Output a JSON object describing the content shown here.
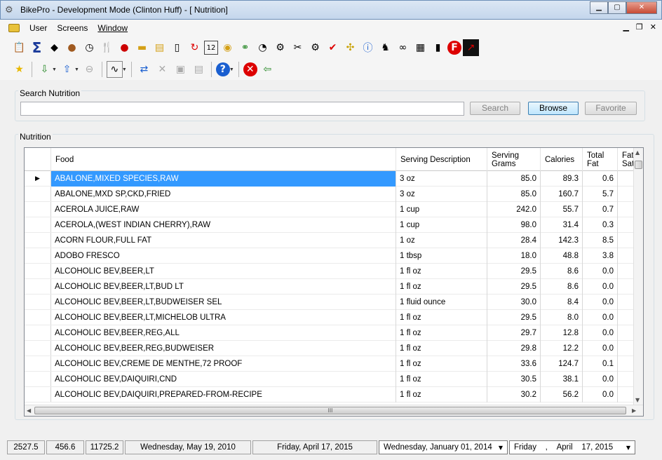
{
  "window": {
    "title": "BikePro - Development Mode (Clinton Huff) - [ Nutrition]"
  },
  "menu": {
    "items": [
      "User",
      "Screens",
      "Window"
    ]
  },
  "toolbar1": {
    "icons": [
      "report-icon",
      "sigma-icon",
      "weight-icon",
      "person-icon",
      "stopwatch-icon",
      "fork-knife-icon",
      "apple-icon",
      "folder-icon",
      "notebook-icon",
      "phone-icon",
      "refresh-red-icon",
      "calendar-icon",
      "medal-icon",
      "bicycle-icon",
      "gauge-icon",
      "bike-parts-icon",
      "tools-icon",
      "gear-wheel-icon",
      "check-icon",
      "molecule-icon",
      "info-icon",
      "animal-icon",
      "binoculars-icon",
      "documents-icon",
      "device-icon",
      "f-logo-icon",
      "chart-red-icon"
    ]
  },
  "toolbar2": {
    "icons": [
      "star-icon",
      "import-icon",
      "export-icon",
      "back-icon",
      "chart-icon",
      "sync-icon",
      "delete-icon",
      "save-icon",
      "save-all-icon",
      "help-icon",
      "cancel-icon",
      "exit-icon"
    ],
    "calendar_day": "12"
  },
  "search": {
    "label": "Search Nutrition",
    "value": "",
    "search_btn": "Search",
    "browse_btn": "Browse",
    "favorite_btn": "Favorite"
  },
  "nutrition": {
    "label": "Nutrition"
  },
  "grid": {
    "columns": [
      {
        "label": "Food",
        "w": 492
      },
      {
        "label": "Serving Description",
        "w": 130
      },
      {
        "label": "Serving\nGrams",
        "w": 76
      },
      {
        "label": "Calories",
        "w": 60
      },
      {
        "label": "Total\nFat",
        "w": 50
      },
      {
        "label": "Fat\nSat",
        "w": 24
      }
    ],
    "rows": [
      [
        "ABALONE,MIXED SPECIES,RAW",
        "3 oz",
        "85.0",
        "89.3",
        "0.6"
      ],
      [
        "ABALONE,MXD SP,CKD,FRIED",
        "3 oz",
        "85.0",
        "160.7",
        "5.7"
      ],
      [
        "ACEROLA JUICE,RAW",
        "1 cup",
        "242.0",
        "55.7",
        "0.7"
      ],
      [
        "ACEROLA,(WEST INDIAN CHERRY),RAW",
        "1 cup",
        "98.0",
        "31.4",
        "0.3"
      ],
      [
        "ACORN FLOUR,FULL FAT",
        "1 oz",
        "28.4",
        "142.3",
        "8.5"
      ],
      [
        "ADOBO FRESCO",
        "1 tbsp",
        "18.0",
        "48.8",
        "3.8"
      ],
      [
        "ALCOHOLIC BEV,BEER,LT",
        "1 fl oz",
        "29.5",
        "8.6",
        "0.0"
      ],
      [
        "ALCOHOLIC BEV,BEER,LT,BUD LT",
        "1 fl oz",
        "29.5",
        "8.6",
        "0.0"
      ],
      [
        "ALCOHOLIC BEV,BEER,LT,BUDWEISER SEL",
        "1 fluid ounce",
        "30.0",
        "8.4",
        "0.0"
      ],
      [
        "ALCOHOLIC BEV,BEER,LT,MICHELOB ULTRA",
        "1 fl oz",
        "29.5",
        "8.0",
        "0.0"
      ],
      [
        "ALCOHOLIC BEV,BEER,REG,ALL",
        "1 fl oz",
        "29.7",
        "12.8",
        "0.0"
      ],
      [
        "ALCOHOLIC BEV,BEER,REG,BUDWEISER",
        "1 fl oz",
        "29.8",
        "12.2",
        "0.0"
      ],
      [
        "ALCOHOLIC BEV,CREME DE MENTHE,72 PROOF",
        "1 fl oz",
        "33.6",
        "124.7",
        "0.1"
      ],
      [
        "ALCOHOLIC BEV,DAIQUIRI,CND",
        "1 fl oz",
        "30.5",
        "38.1",
        "0.0"
      ],
      [
        "ALCOHOLIC BEV,DAIQUIRI,PREPARED-FROM-RECIPE",
        "1 fl oz",
        "30.2",
        "56.2",
        "0.0"
      ]
    ],
    "hscroll_grip": "III"
  },
  "status": {
    "values": [
      "2527.5",
      "456.6",
      "11725.2"
    ],
    "date1": "Wednesday, May 19, 2010",
    "date2": "Friday, April 17, 2015",
    "picker1": {
      "day": "Wednesday,",
      "month": "January",
      "date": "01, 2014"
    },
    "picker2": {
      "day": "Friday",
      "sep": ",",
      "month": "April",
      "date": "17, 2015"
    }
  }
}
